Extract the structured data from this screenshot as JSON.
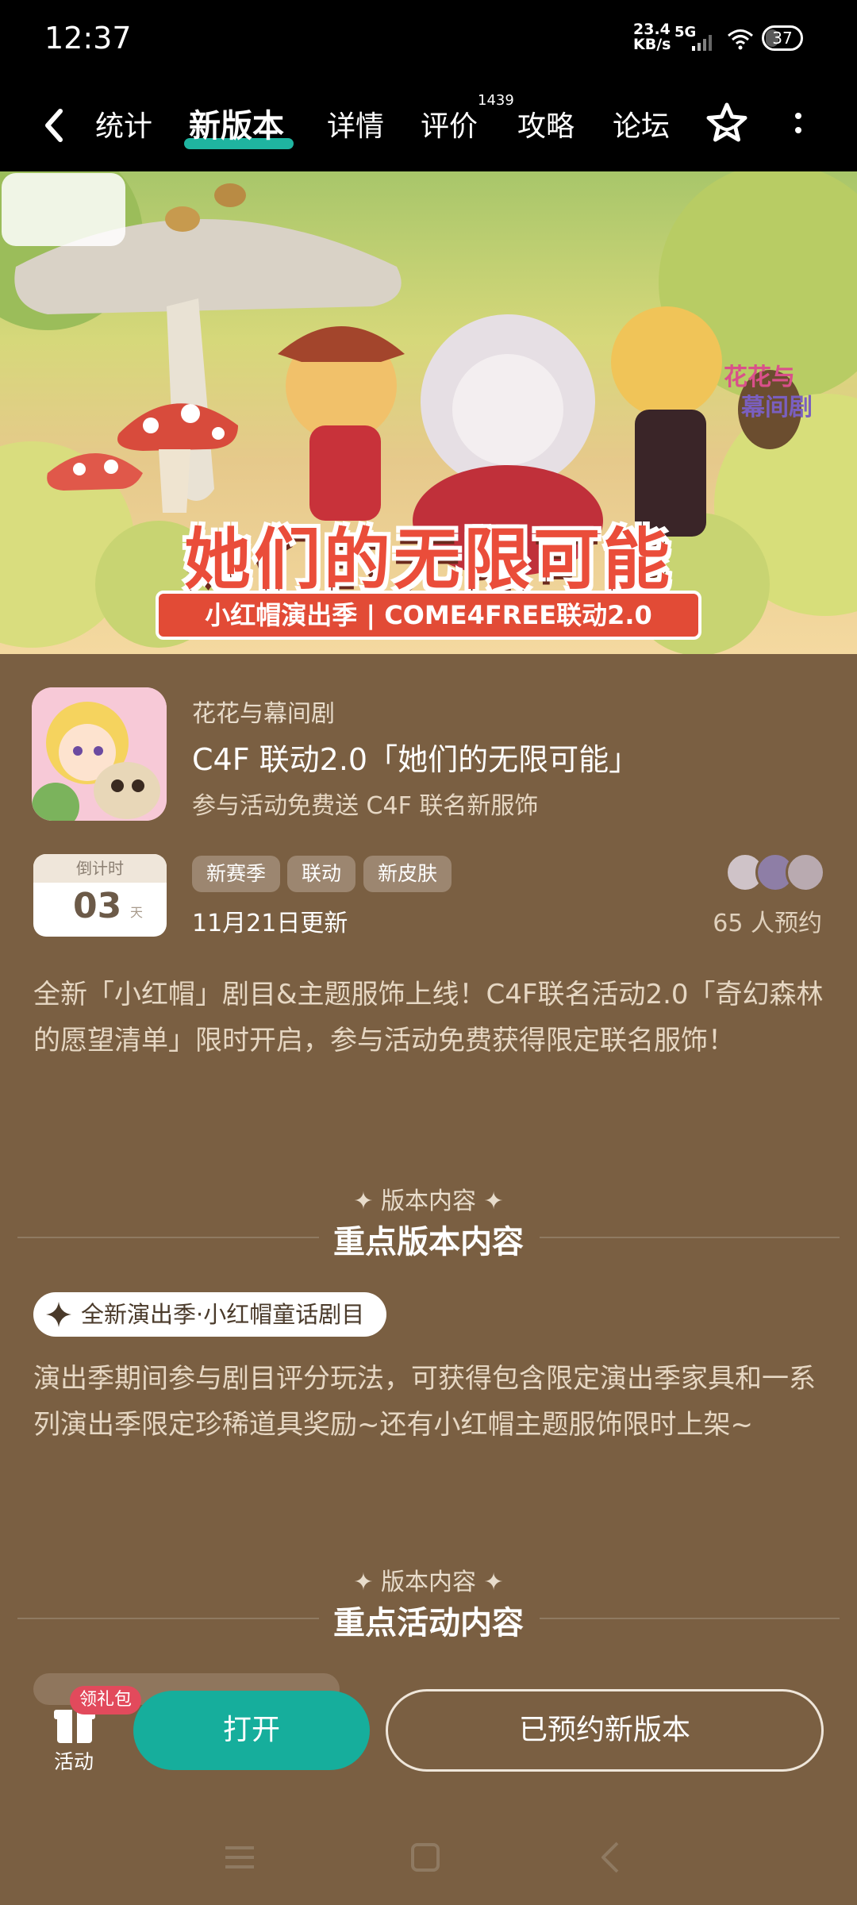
{
  "status_bar": {
    "time": "12:37",
    "net_speed_value": "23.4",
    "net_speed_unit": "KB/s",
    "network": "5G",
    "battery": "37"
  },
  "nav": {
    "tabs": [
      {
        "label": "统计"
      },
      {
        "label": "新版本"
      },
      {
        "label": "详情"
      },
      {
        "label": "评价"
      },
      {
        "label": "攻略"
      },
      {
        "label": "论坛"
      }
    ],
    "active_tab": "新版本",
    "review_count": "1439"
  },
  "banner": {
    "logo_text_1": "花花与",
    "logo_text_2": "幕间剧",
    "title": "她们的无限可能",
    "subtitle": "小红帽演出季 | COME4FREE联动2.0"
  },
  "app": {
    "publisher": "花花与幕间剧",
    "title": "C4F 联动2.0「她们的无限可能」",
    "subtitle": "参与活动免费送 C4F 联名新服饰"
  },
  "countdown": {
    "label": "倒计时",
    "value": "03",
    "unit": "天"
  },
  "tags": [
    "新赛季",
    "联动",
    "新皮肤"
  ],
  "update_date": "11月21日更新",
  "reservation_text": "65 人预约",
  "description": "全新「小红帽」剧目&主题服饰上线！C4F联名活动2.0「奇幻森林的愿望清单」限时开启，参与活动免费获得限定联名服饰！",
  "section1": {
    "kicker": "版本内容",
    "title": "重点版本内容"
  },
  "feature": {
    "pill": "全新演出季·小红帽童话剧目",
    "text": "演出季期间参与剧目评分玩法，可获得包含限定演出季家具和一系列演出季限定珍稀道具奖励~还有小红帽主题服饰限时上架~"
  },
  "section2": {
    "kicker": "版本内容",
    "title": "重点活动内容"
  },
  "bottom": {
    "gift_badge": "领礼包",
    "gift_label": "活动",
    "open_button": "打开",
    "reserved_button": "已预约新版本"
  },
  "colors": {
    "background": "#7a5f42",
    "accent": "#16ae9c",
    "tag": "#9c8670",
    "badge": "#e24a5c"
  }
}
